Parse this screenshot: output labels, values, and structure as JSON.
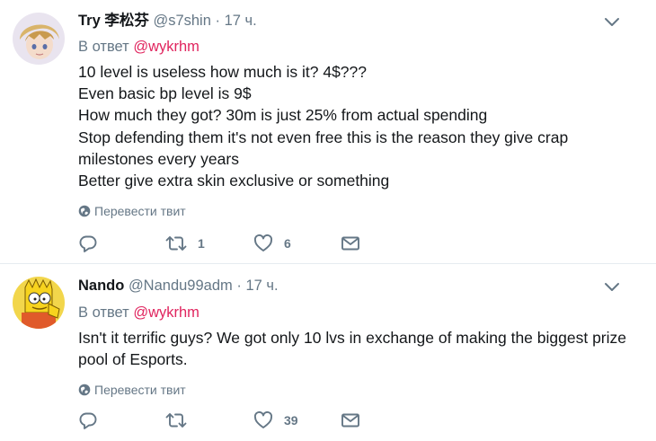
{
  "tweets": [
    {
      "name": "Try 李松芬",
      "handle": "@s7shin",
      "dot": "·",
      "time": "17 ч.",
      "reply_prefix": "В ответ",
      "reply_to": "@wykrhm",
      "text_lines": [
        "10 level is useless how much is it? 4$???",
        "Even basic bp level is 9$",
        "How much they got? 30m is just 25% from actual spending",
        "Stop defending them it's not even free this is the reason they give crap",
        "milestones every years",
        "Better give extra skin exclusive or something"
      ],
      "translate": "Перевести твит",
      "retweets": "1",
      "likes": "6"
    },
    {
      "name": "Nando",
      "handle": "@Nandu99adm",
      "dot": "·",
      "time": "17 ч.",
      "reply_prefix": "В ответ",
      "reply_to": "@wykrhm",
      "text_lines": [
        "Isn't it terrific guys? We got only 10 lvs in exchange of making the biggest prize",
        "pool of Esports."
      ],
      "translate": "Перевести твит",
      "retweets": "",
      "likes": "39"
    }
  ],
  "icons": {
    "caret": "chevron-down-icon",
    "globe": "globe-icon",
    "reply": "reply-icon",
    "retweet": "retweet-icon",
    "like": "heart-icon",
    "dm": "envelope-icon"
  },
  "colors": {
    "text": "#14171a",
    "muted": "#657786",
    "mention": "#e0245e",
    "divider": "#e6ecf0"
  }
}
